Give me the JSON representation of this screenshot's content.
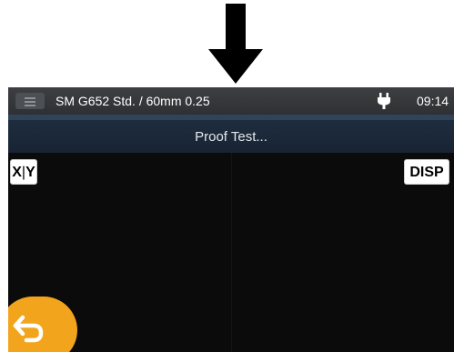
{
  "status_bar": {
    "profile": "SM G652 Std. / 60mm 0.25",
    "time": "09:14",
    "menu_icon": "hamburger-menu-icon",
    "power_icon": "ac-plug-icon"
  },
  "header": {
    "title": "Proof Test..."
  },
  "buttons": {
    "xy_left": "X",
    "xy_separator": "|",
    "xy_right": "Y",
    "disp": "DISP",
    "back_icon": "back-arrow-icon"
  },
  "indicator": {
    "icon": "down-arrow-icon"
  },
  "colors": {
    "screen_background": "#0b0b0c",
    "title_bar": "#1f2e40",
    "back_button": "#f2a51c"
  }
}
